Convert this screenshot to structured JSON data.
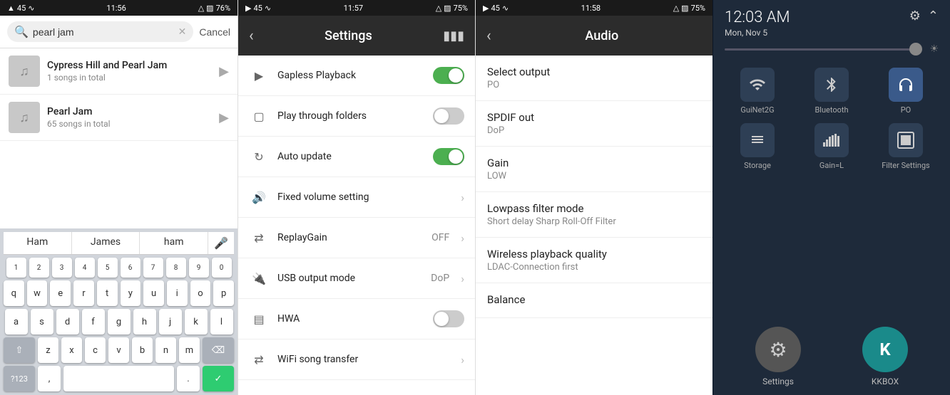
{
  "panel1": {
    "status": {
      "left": "45",
      "time": "11:56",
      "right": "76%"
    },
    "search": {
      "value": "pearl jam",
      "cancel_label": "Cancel"
    },
    "music_items": [
      {
        "title": "Cypress Hill and Pearl Jam",
        "subtitle": "1 songs in total"
      },
      {
        "title": "Pearl Jam",
        "subtitle": "65 songs in total"
      }
    ],
    "keyboard": {
      "suggestions": [
        "Ham",
        "James",
        "ham"
      ],
      "rows": [
        [
          "1",
          "2",
          "3",
          "4",
          "5",
          "6",
          "7",
          "8",
          "9",
          "0"
        ],
        [
          "q",
          "w",
          "e",
          "r",
          "t",
          "y",
          "u",
          "i",
          "o",
          "p"
        ],
        [
          "a",
          "s",
          "d",
          "f",
          "g",
          "h",
          "j",
          "k",
          "l"
        ],
        [
          "z",
          "x",
          "c",
          "v",
          "b",
          "n",
          "m"
        ],
        [
          "?123",
          ",",
          "",
          ".",
          "✓"
        ]
      ]
    }
  },
  "panel2": {
    "status": {
      "left": "45",
      "time": "11:57",
      "right": "75%"
    },
    "header": {
      "title": "Settings",
      "back_label": "‹"
    },
    "items": [
      {
        "icon": "▶",
        "label": "Gapless Playback",
        "control": "toggle-on"
      },
      {
        "icon": "□",
        "label": "Play through folders",
        "control": "toggle-off"
      },
      {
        "icon": "↺",
        "label": "Auto update",
        "control": "toggle-on"
      },
      {
        "icon": "◔",
        "label": "Fixed volume setting",
        "control": "chevron"
      },
      {
        "icon": "⇄",
        "label": "ReplayGain",
        "control": "value-chevron",
        "value": "OFF"
      },
      {
        "icon": "□",
        "label": "USB output mode",
        "control": "value-chevron",
        "value": "DoP"
      },
      {
        "icon": "□",
        "label": "HWA",
        "control": "toggle-off"
      },
      {
        "icon": "□",
        "label": "WiFi song transfer",
        "control": "chevron"
      }
    ]
  },
  "panel3": {
    "status": {
      "left": "45",
      "time": "11:58",
      "right": "75%"
    },
    "header": {
      "title": "Audio",
      "back_label": "‹"
    },
    "items": [
      {
        "title": "Select output",
        "subtitle": "PO"
      },
      {
        "title": "SPDIF out",
        "subtitle": "DoP"
      },
      {
        "title": "Gain",
        "subtitle": "LOW"
      },
      {
        "title": "Lowpass filter mode",
        "subtitle": "Short delay Sharp Roll-Off Filter"
      },
      {
        "title": "Wireless playback quality",
        "subtitle": "LDAC-Connection first"
      },
      {
        "title": "Balance",
        "subtitle": ""
      }
    ]
  },
  "panel4": {
    "time": "12:03 AM",
    "date": "Mon, Nov 5",
    "tiles": [
      {
        "icon": "▼",
        "label": "GuiNet2G",
        "active": false
      },
      {
        "icon": "⌬",
        "label": "Bluetooth",
        "active": false
      },
      {
        "icon": "🎧",
        "label": "PO",
        "active": true
      },
      {
        "icon": "📁",
        "label": "Storage",
        "active": false
      },
      {
        "icon": "▇",
        "label": "Gain=L",
        "active": false
      },
      {
        "icon": "▣",
        "label": "Filter Settings",
        "active": false
      }
    ],
    "apps": [
      {
        "icon": "⚙",
        "label": "Settings",
        "type": "settings-app"
      },
      {
        "icon": "K",
        "label": "KKBOX",
        "type": "kkbox-app"
      }
    ]
  }
}
